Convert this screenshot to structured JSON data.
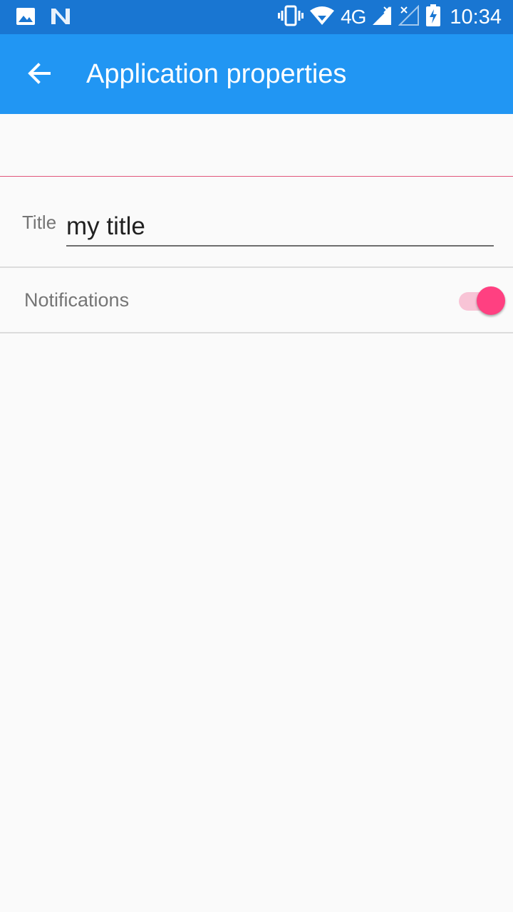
{
  "status_bar": {
    "time": "10:34",
    "network_label": "4G",
    "left_icons": [
      "image-icon",
      "n-notification-icon"
    ],
    "right_icons": [
      "vibrate-icon",
      "wifi-icon",
      "signal-icon",
      "signal-no-sim-icon",
      "battery-charging-icon"
    ],
    "color": "#1976d2"
  },
  "app_bar": {
    "title": "Application properties",
    "back_icon": "arrow-back-icon",
    "color": "#2196f3"
  },
  "form": {
    "title_label": "Title",
    "title_value": "my title",
    "notifications_label": "Notifications",
    "notifications_enabled": true,
    "accent_color": "#ff4081"
  }
}
